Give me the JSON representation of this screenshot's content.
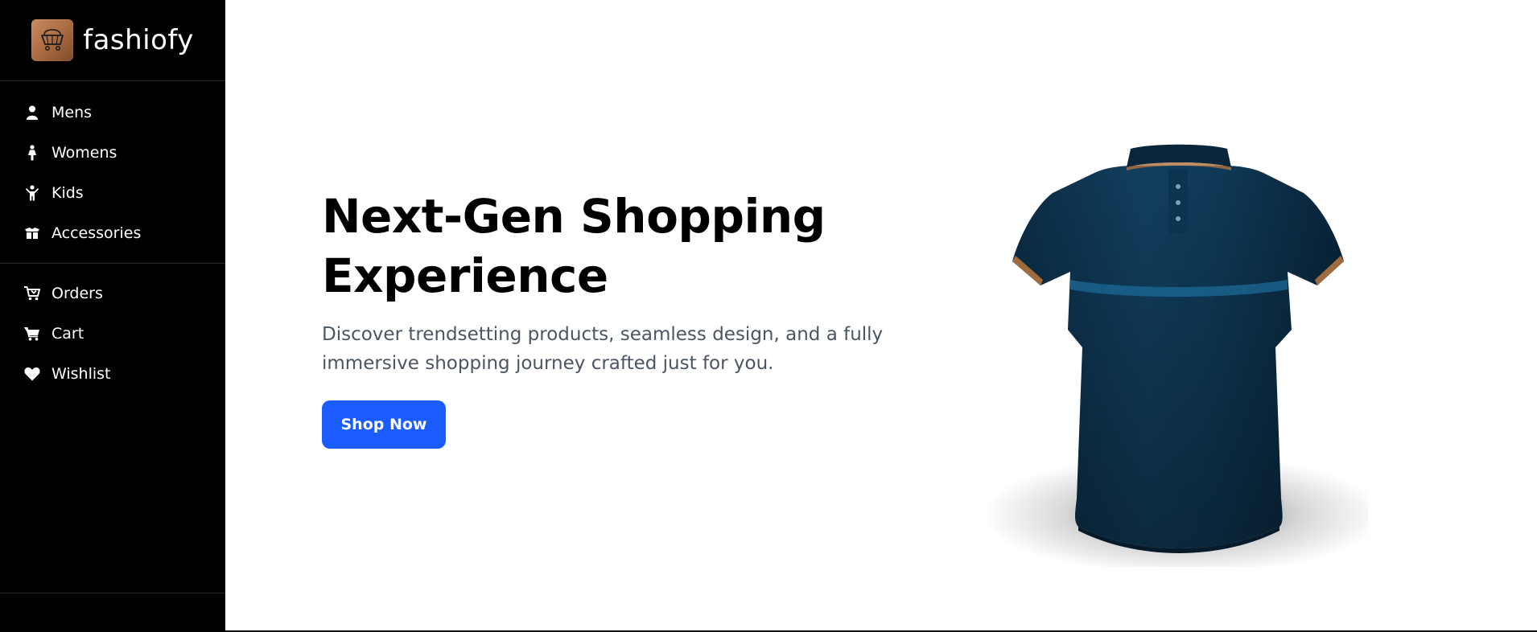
{
  "brand": {
    "name": "fashiofy",
    "logo_icon": "shopping-cart-icon"
  },
  "sidebar": {
    "categories": [
      {
        "label": "Mens",
        "icon": "person-icon"
      },
      {
        "label": "Womens",
        "icon": "woman-icon"
      },
      {
        "label": "Kids",
        "icon": "child-icon"
      },
      {
        "label": "Accessories",
        "icon": "box-icon"
      }
    ],
    "account": [
      {
        "label": "Orders",
        "icon": "cart-arrow-icon"
      },
      {
        "label": "Cart",
        "icon": "cart-icon"
      },
      {
        "label": "Wishlist",
        "icon": "heart-icon"
      }
    ]
  },
  "hero": {
    "title_line1": "Next-Gen Shopping",
    "title_line2": "Experience",
    "description": "Discover trendsetting products, seamless design, and a fully immersive shopping journey crafted just for you.",
    "cta_label": "Shop Now",
    "image": "polo-shirt-image"
  },
  "colors": {
    "sidebar_bg": "#000000",
    "accent": "#1a5cff",
    "heading": "#000000",
    "body_text": "#4b5563"
  }
}
